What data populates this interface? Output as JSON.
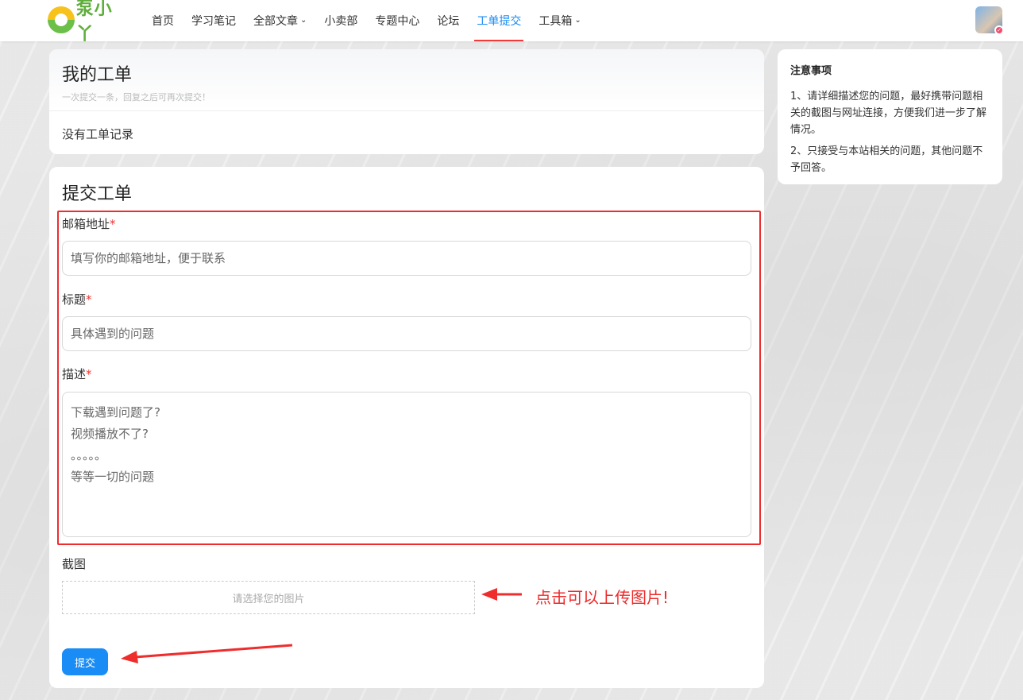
{
  "header": {
    "logo_text": "泵小丫",
    "nav": [
      {
        "label": "首页",
        "dropdown": false,
        "active": false
      },
      {
        "label": "学习笔记",
        "dropdown": false,
        "active": false
      },
      {
        "label": "全部文章",
        "dropdown": true,
        "active": false
      },
      {
        "label": "小卖部",
        "dropdown": false,
        "active": false
      },
      {
        "label": "专题中心",
        "dropdown": false,
        "active": false
      },
      {
        "label": "论坛",
        "dropdown": false,
        "active": false
      },
      {
        "label": "工单提交",
        "dropdown": false,
        "active": true
      },
      {
        "label": "工具箱",
        "dropdown": true,
        "active": false
      }
    ]
  },
  "my_tickets": {
    "title": "我的工单",
    "subtitle": "一次提交一条，回复之后可再次提交！",
    "empty_text": "没有工单记录"
  },
  "submit": {
    "title": "提交工单",
    "email": {
      "label": "邮箱地址",
      "required": "*",
      "placeholder": "填写你的邮箱地址，便于联系"
    },
    "subject": {
      "label": "标题",
      "required": "*",
      "placeholder": "具体遇到的问题"
    },
    "description": {
      "label": "描述",
      "required": "*",
      "placeholder": "下载遇到问题了?\n视频播放不了?\n。。。。。\n等等一切的问题"
    },
    "screenshot": {
      "label": "截图",
      "upload_text": "请选择您的图片"
    },
    "upload_annotation": "点击可以上传图片!",
    "submit_label": "提交"
  },
  "notice": {
    "title": "注意事项",
    "items": [
      "1、请详细描述您的问题，最好携带问题相关的截图与网址连接，方便我们进一步了解情况。",
      "2、只接受与本站相关的问题，其他问题不予回答。"
    ]
  },
  "colors": {
    "accent": "#1a8cf5",
    "annotation_red": "#ef2d2d"
  }
}
